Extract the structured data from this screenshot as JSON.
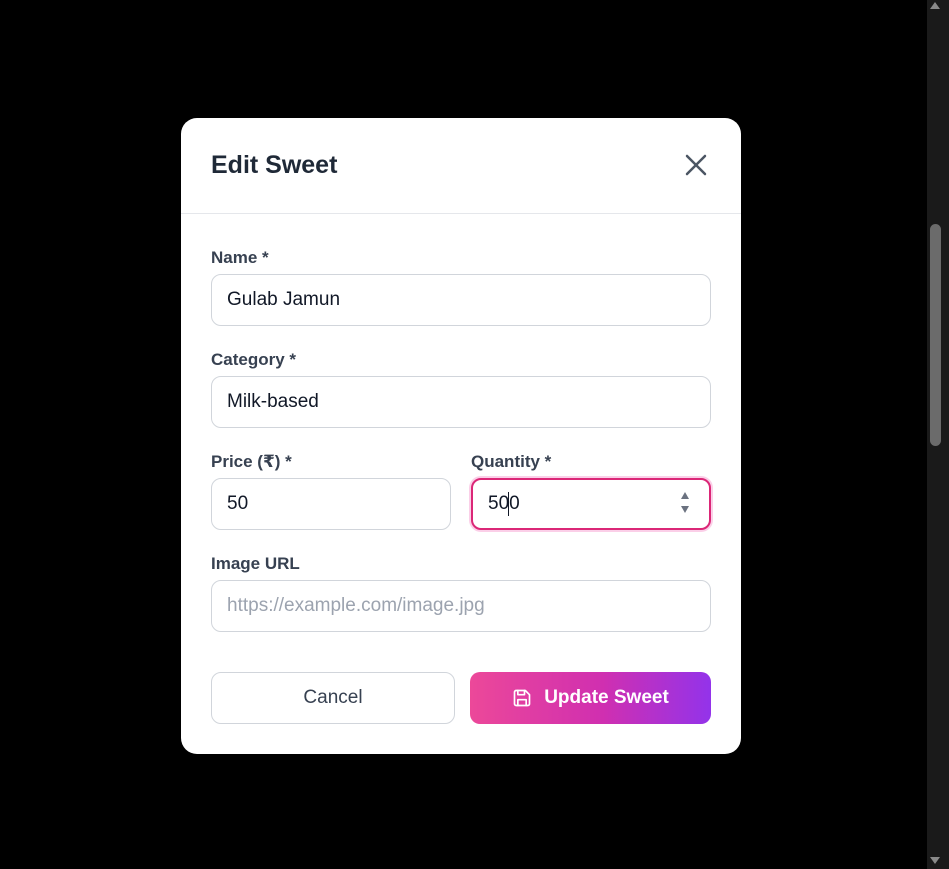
{
  "modal": {
    "title": "Edit Sweet",
    "close_icon": "close-icon"
  },
  "form": {
    "name": {
      "label": "Name *",
      "value": "Gulab Jamun",
      "placeholder": ""
    },
    "category": {
      "label": "Category *",
      "value": "Milk-based",
      "placeholder": ""
    },
    "price": {
      "label": "Price (₹) *",
      "value": "50",
      "placeholder": ""
    },
    "quantity": {
      "label": "Quantity *",
      "value": "500",
      "placeholder": ""
    },
    "image_url": {
      "label": "Image URL",
      "value": "",
      "placeholder": "https://example.com/image.jpg"
    }
  },
  "buttons": {
    "cancel_label": "Cancel",
    "update_label": "Update Sweet",
    "update_icon": "save-icon"
  },
  "colors": {
    "accent_start": "#ec4899",
    "accent_end": "#9333ea",
    "focus_border": "#db2777",
    "backdrop": "#000000"
  }
}
